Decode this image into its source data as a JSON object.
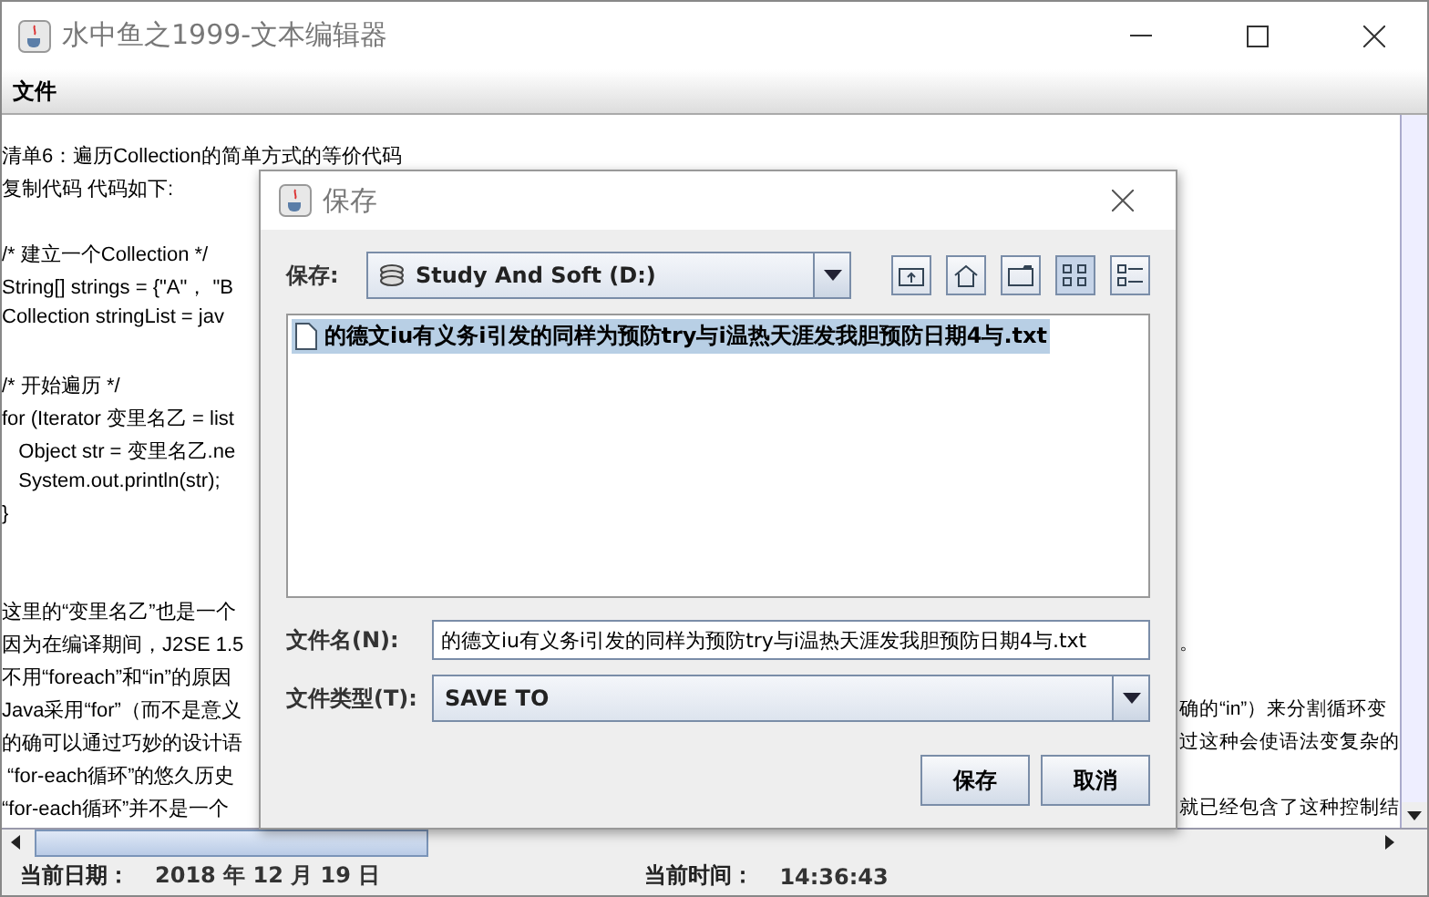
{
  "window": {
    "title": "水中鱼之1999-文本编辑器"
  },
  "menu": [
    {
      "label": "文件"
    }
  ],
  "editor_blocks": [
    {
      "lines": [
        {
          "left": "清单6：遍历Collection的简单方式的等价代码"
        },
        {
          "left": "复制代码 代码如下:"
        }
      ]
    },
    {
      "lines": [
        {
          "left": "/* 建立一个Collection */"
        },
        {
          "left": "String[] strings = {\"A\"， \"B"
        },
        {
          "left": "Collection stringList = jav"
        }
      ]
    },
    {
      "lines": [
        {
          "left": "/* 开始遍历 */"
        },
        {
          "left": "for (Iterator 变里名乙 = list"
        },
        {
          "left": "   Object str = 变里名乙.ne"
        },
        {
          "left": "   System.out.println(str);"
        },
        {
          "left": "}"
        }
      ]
    },
    {
      "lines": [
        {
          "left": "这里的“变里名乙”也是一个"
        },
        {
          "left": "因为在编译期间，J2SE 1.5",
          "right": "。"
        },
        {
          "left": "不用“foreach”和“in”的原因"
        },
        {
          "left": "Java采用“for”（而不是意义",
          "right": "确的“in”）来分割循环变"
        },
        {
          "left": "的确可以通过巧妙的设计语",
          "right": "过这种会使语法变复杂的"
        },
        {
          "left": " “for-each循环”的悠久历史"
        },
        {
          "left": "“for-each循环”并不是一个",
          "right": "就已经包含了这种控制结"
        }
      ]
    }
  ],
  "dialog": {
    "title": "保存",
    "save_in_label": "保存:",
    "location": "Study And Soft (D:)",
    "tools": [
      {
        "kind": "up",
        "selected": false
      },
      {
        "kind": "home",
        "selected": false
      },
      {
        "kind": "newfolder",
        "selected": false
      },
      {
        "kind": "list",
        "selected": true
      },
      {
        "kind": "details",
        "selected": false
      }
    ],
    "files": [
      {
        "name": "的德文iu有义务i引发的同样为预防try与i温热天涯发我胆预防日期4与.txt",
        "selected": true
      }
    ],
    "file_name_label": "文件名(N):",
    "file_name": "的德文iu有义务i引发的同样为预防try与i温热天涯发我胆预防日期4与.txt",
    "file_type_label": "文件类型(T):",
    "file_type": "SAVE TO",
    "buttons": [
      {
        "label": "保存"
      },
      {
        "label": "取消"
      }
    ]
  },
  "status_bar": {
    "date_label": "当前日期：",
    "date": "2018 年 12 月 19 日",
    "time_label": "当前时间：",
    "time": "14:36:43"
  }
}
